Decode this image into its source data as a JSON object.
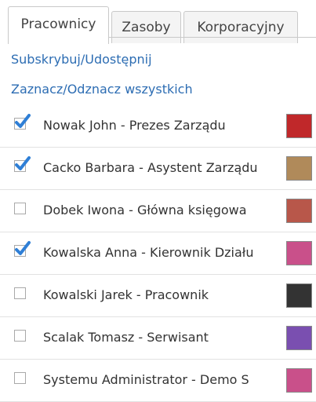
{
  "tabs": [
    {
      "label": "Pracownicy",
      "active": true
    },
    {
      "label": "Zasoby",
      "active": false
    },
    {
      "label": "Korporacyjny",
      "active": false
    }
  ],
  "links": {
    "subscribe": "Subskrybuj/Udostępnij",
    "select_all": "Zaznacz/Odznacz wszystkich"
  },
  "employees": [
    {
      "name": "Nowak John - Prezes Zarządu",
      "checked": true,
      "color": "#c0282a"
    },
    {
      "name": "Cacko Barbara - Asystent Zarządu",
      "checked": true,
      "color": "#b08a5a"
    },
    {
      "name": "Dobek Iwona - Główna księgowa",
      "checked": false,
      "color": "#b8574a"
    },
    {
      "name": "Kowalska Anna - Kierownik Działu",
      "checked": true,
      "color": "#c9508a"
    },
    {
      "name": "Kowalski Jarek - Pracownik",
      "checked": false,
      "color": "#333333"
    },
    {
      "name": "Scalak Tomasz - Serwisant",
      "checked": false,
      "color": "#7a4fb0"
    },
    {
      "name": "Systemu Administrator - Demo S",
      "checked": false,
      "color": "#c9508a"
    }
  ],
  "colors": {
    "link": "#2d6db3",
    "checkmark": "#2f7fd6"
  }
}
